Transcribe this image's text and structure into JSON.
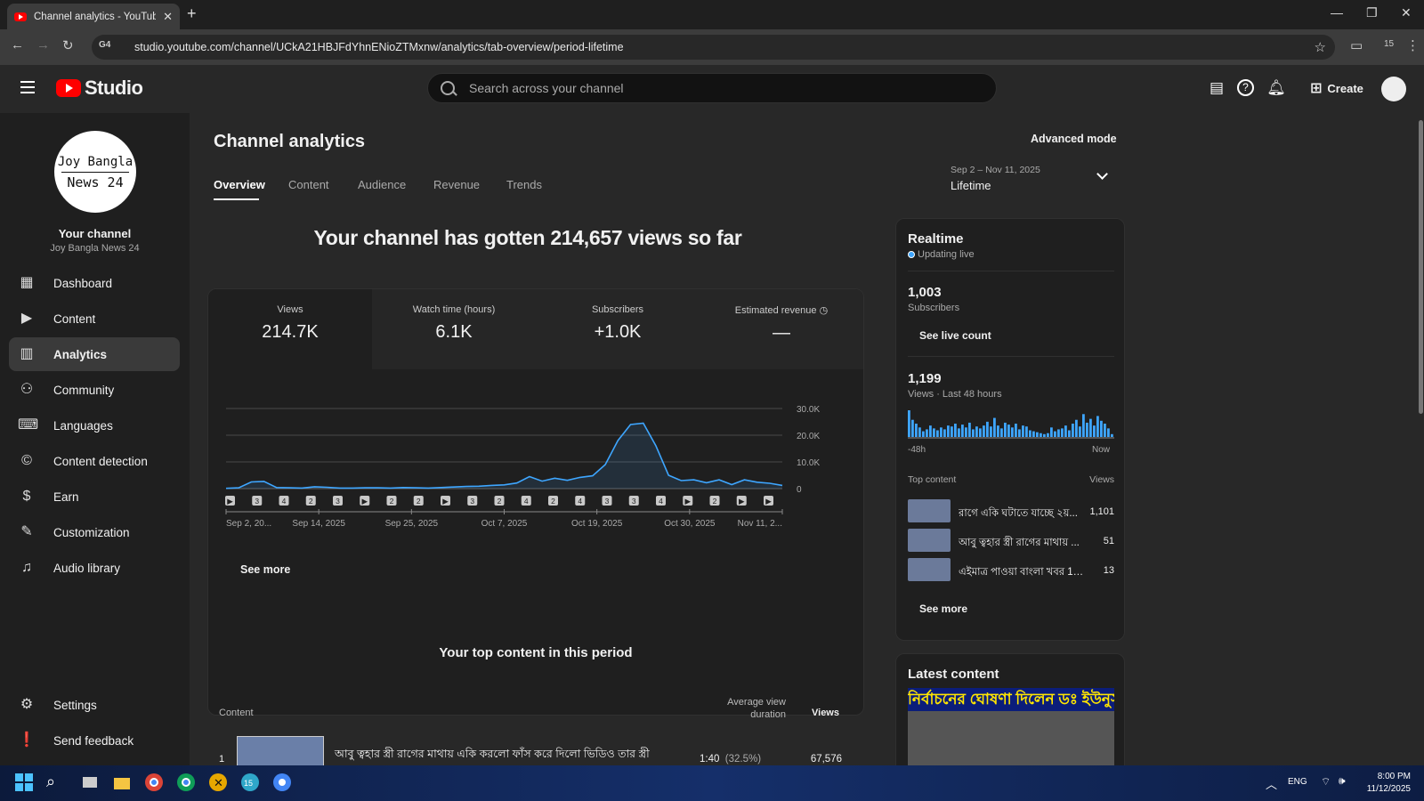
{
  "browser": {
    "tab_title": "Channel analytics - YouTube Studio",
    "url": "studio.youtube.com/channel/UCkA21HBJFdYhnENioZTMxnw/analytics/tab-overview/period-lifetime",
    "site_badge": "G4",
    "extensions_count": "15"
  },
  "header": {
    "logo_text": "Studio",
    "search_placeholder": "Search across your channel",
    "create_label": "Create"
  },
  "sidebar": {
    "avatar_line1": "Joy Bangla",
    "avatar_line2": "News 24",
    "your_channel": "Your channel",
    "channel_name": "Joy Bangla News 24",
    "items": [
      {
        "label": "Dashboard",
        "icon": "dashboard-icon"
      },
      {
        "label": "Content",
        "icon": "content-icon"
      },
      {
        "label": "Analytics",
        "icon": "analytics-icon"
      },
      {
        "label": "Community",
        "icon": "community-icon"
      },
      {
        "label": "Languages",
        "icon": "languages-icon"
      },
      {
        "label": "Content detection",
        "icon": "copyright-icon"
      },
      {
        "label": "Earn",
        "icon": "dollar-icon"
      },
      {
        "label": "Customization",
        "icon": "magic-wand-icon"
      },
      {
        "label": "Audio library",
        "icon": "music-icon"
      }
    ],
    "bottom": [
      {
        "label": "Settings",
        "icon": "gear-icon"
      },
      {
        "label": "Send feedback",
        "icon": "feedback-icon"
      }
    ]
  },
  "main": {
    "title": "Channel analytics",
    "advanced_mode": "Advanced mode",
    "tabs": [
      "Overview",
      "Content",
      "Audience",
      "Revenue",
      "Trends"
    ],
    "date_range": "Sep 2 – Nov 11, 2025",
    "period": "Lifetime",
    "headline": "Your channel has gotten 214,657 views so far",
    "metrics": [
      {
        "label": "Views",
        "value": "214.7K"
      },
      {
        "label": "Watch time (hours)",
        "value": "6.1K"
      },
      {
        "label": "Subscribers",
        "value": "+1.0K"
      },
      {
        "label": "Estimated revenue",
        "value": "—"
      }
    ],
    "see_more": "See more",
    "top_content_title": "Your top content in this period",
    "table_headers": {
      "content": "Content",
      "avd": "Average view duration",
      "views": "Views"
    },
    "top_rows": [
      {
        "rank": "1",
        "title": "আবু ত্বহার স্ত্রী রাগের মাথায় একি করলো ফাঁস করে দিলো ভিডিও তার স্ত্রী",
        "avd": "1:40",
        "avd_pct": "(32.5%)",
        "views": "67,576"
      }
    ]
  },
  "chart_data": {
    "type": "line",
    "x_tick_labels": [
      "Sep 2, 20...",
      "Sep 14, 2025",
      "Sep 25, 2025",
      "Oct 7, 2025",
      "Oct 19, 2025",
      "Oct 30, 2025",
      "Nov 11, 2..."
    ],
    "y_tick_labels": [
      "30.0K",
      "20.0K",
      "10.0K",
      "0"
    ],
    "ylim": [
      0,
      30000
    ],
    "series": [
      {
        "values": [
          100,
          300,
          2500,
          2700,
          400,
          300,
          200,
          700,
          500,
          200,
          200,
          300,
          300,
          200,
          400,
          300,
          200,
          400,
          600,
          800,
          900,
          1200,
          1400,
          2100,
          4500,
          2800,
          3900,
          3100,
          4200,
          4800,
          9000,
          18000,
          24000,
          24500,
          16000,
          5000,
          3000,
          3300,
          2200,
          3300,
          1500,
          3300,
          2400,
          2000,
          1200
        ]
      }
    ],
    "markers": [
      "▶",
      "3",
      "4",
      "2",
      "3",
      "▶",
      "2",
      "2",
      "▶",
      "3",
      "2",
      "4",
      "2",
      "4",
      "3",
      "3",
      "4",
      "▶",
      "2",
      "▶",
      "▶"
    ],
    "grid": true,
    "color": "#3ea6ff"
  },
  "realtime": {
    "title": "Realtime",
    "live_label": "Updating live",
    "subs_value": "1,003",
    "subs_label": "Subscribers",
    "see_live": "See live count",
    "views_value": "1,199",
    "views_label": "Views · Last 48 hours",
    "axis_start": "-48h",
    "axis_end": "Now",
    "bars": [
      28,
      18,
      14,
      10,
      6,
      8,
      12,
      9,
      7,
      10,
      8,
      12,
      11,
      14,
      9,
      13,
      10,
      15,
      8,
      11,
      9,
      12,
      16,
      11,
      20,
      12,
      9,
      15,
      13,
      10,
      14,
      8,
      12,
      11,
      7,
      6,
      5,
      4,
      3,
      4,
      10,
      6,
      8,
      9,
      12,
      7,
      14,
      18,
      11,
      24,
      15,
      19,
      12,
      22,
      17,
      14,
      9,
      3
    ],
    "top_content_label": "Top content",
    "top_views_label": "Views",
    "top_rows": [
      {
        "title": "রাগে একি ঘটাতে যাচ্ছে ২য়...",
        "views": "1,101"
      },
      {
        "title": "আবু ত্বহার স্ত্রী রাগের মাথায় ...",
        "views": "51"
      },
      {
        "title": "এইমাত্র পাওয়া বাংলা খবর 10 ...",
        "views": "13"
      }
    ],
    "see_more": "See more"
  },
  "latest": {
    "title": "Latest content",
    "thumb_text": "নির্বাচনের ঘোষণা দিলেন ডঃ ইউনুস"
  },
  "taskbar": {
    "lang": "ENG",
    "time": "8:00 PM",
    "date": "11/12/2025",
    "badge": "15"
  }
}
